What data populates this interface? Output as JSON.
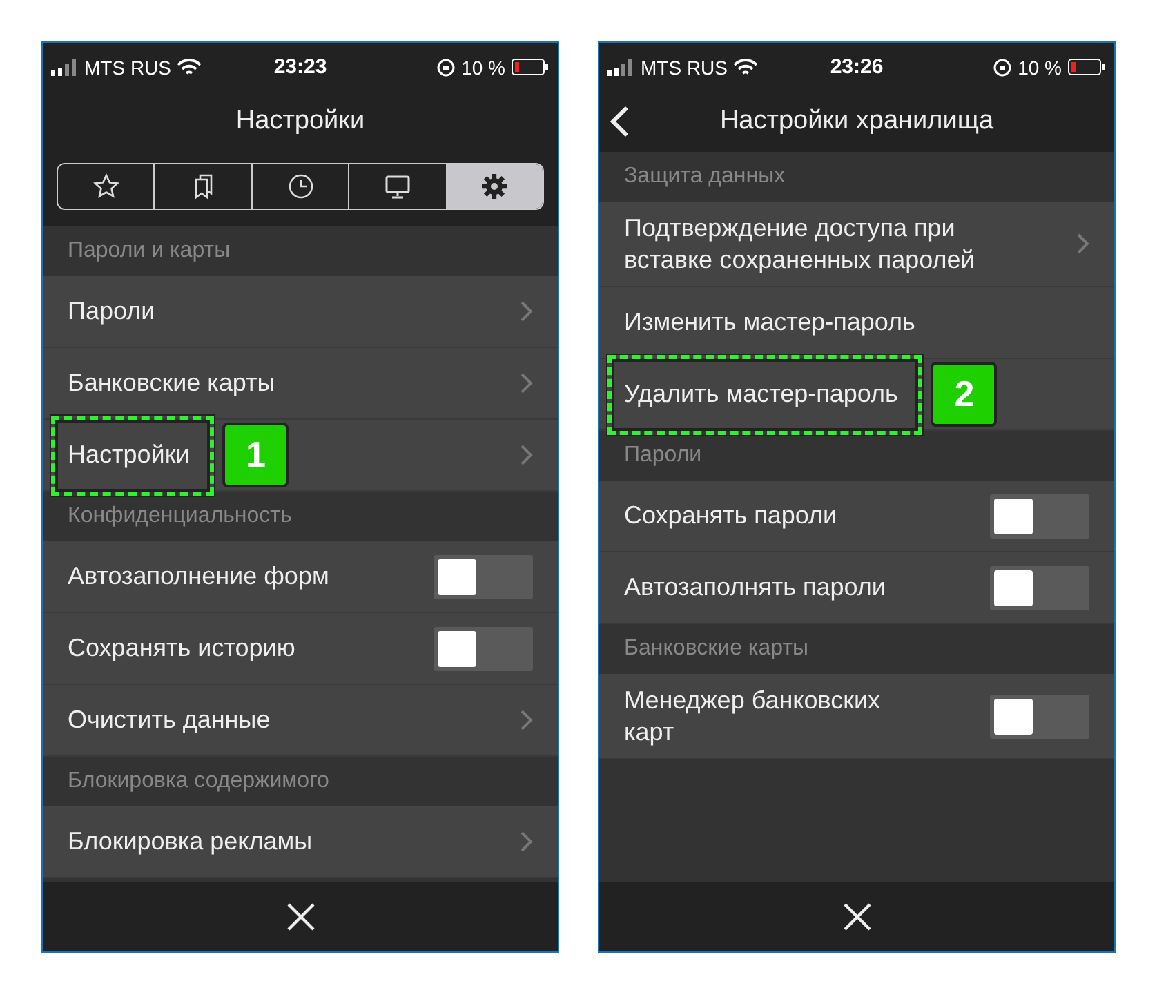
{
  "screens": [
    {
      "status_bar": {
        "carrier": "MTS RUS",
        "time": "23:23",
        "battery": "10 %"
      },
      "title": "Настройки",
      "back_button": false,
      "tabs": [
        {
          "selected": false
        },
        {
          "selected": false
        },
        {
          "selected": false
        },
        {
          "selected": false
        },
        {
          "selected": true
        }
      ],
      "rows": [
        {
          "kind": "section",
          "label": "Пароли и карты"
        },
        {
          "kind": "link",
          "label": "Пароли"
        },
        {
          "kind": "link",
          "label": "Банковские карты"
        },
        {
          "kind": "link",
          "label": "Настройки",
          "annotation": "1"
        },
        {
          "kind": "section",
          "label": "Конфиденциальность"
        },
        {
          "kind": "toggle",
          "label": "Автозаполнение форм",
          "on": false
        },
        {
          "kind": "toggle",
          "label": "Сохранять историю",
          "on": false
        },
        {
          "kind": "link",
          "label": "Очистить данные"
        },
        {
          "kind": "section",
          "label": "Блокировка содержимого"
        },
        {
          "kind": "link",
          "label": "Блокировка рекламы"
        }
      ]
    },
    {
      "status_bar": {
        "carrier": "MTS RUS",
        "time": "23:26",
        "battery": "10 %"
      },
      "title": "Настройки хранилища",
      "back_button": true,
      "rows": [
        {
          "kind": "section",
          "label": "Защита данных"
        },
        {
          "kind": "link",
          "label": "Подтверждение доступа при вставке сохраненных паролей"
        },
        {
          "kind": "plain",
          "label": "Изменить мастер-пароль"
        },
        {
          "kind": "plain",
          "label": "Удалить мастер-пароль",
          "annotation": "2"
        },
        {
          "kind": "section",
          "label": "Пароли"
        },
        {
          "kind": "toggle",
          "label": "Сохранять пароли",
          "on": false
        },
        {
          "kind": "toggle",
          "label": "Автозаполнять пароли",
          "on": false
        },
        {
          "kind": "section",
          "label": "Банковские карты"
        },
        {
          "kind": "toggle",
          "label": "Менеджер банковских карт",
          "on": false
        }
      ]
    }
  ]
}
